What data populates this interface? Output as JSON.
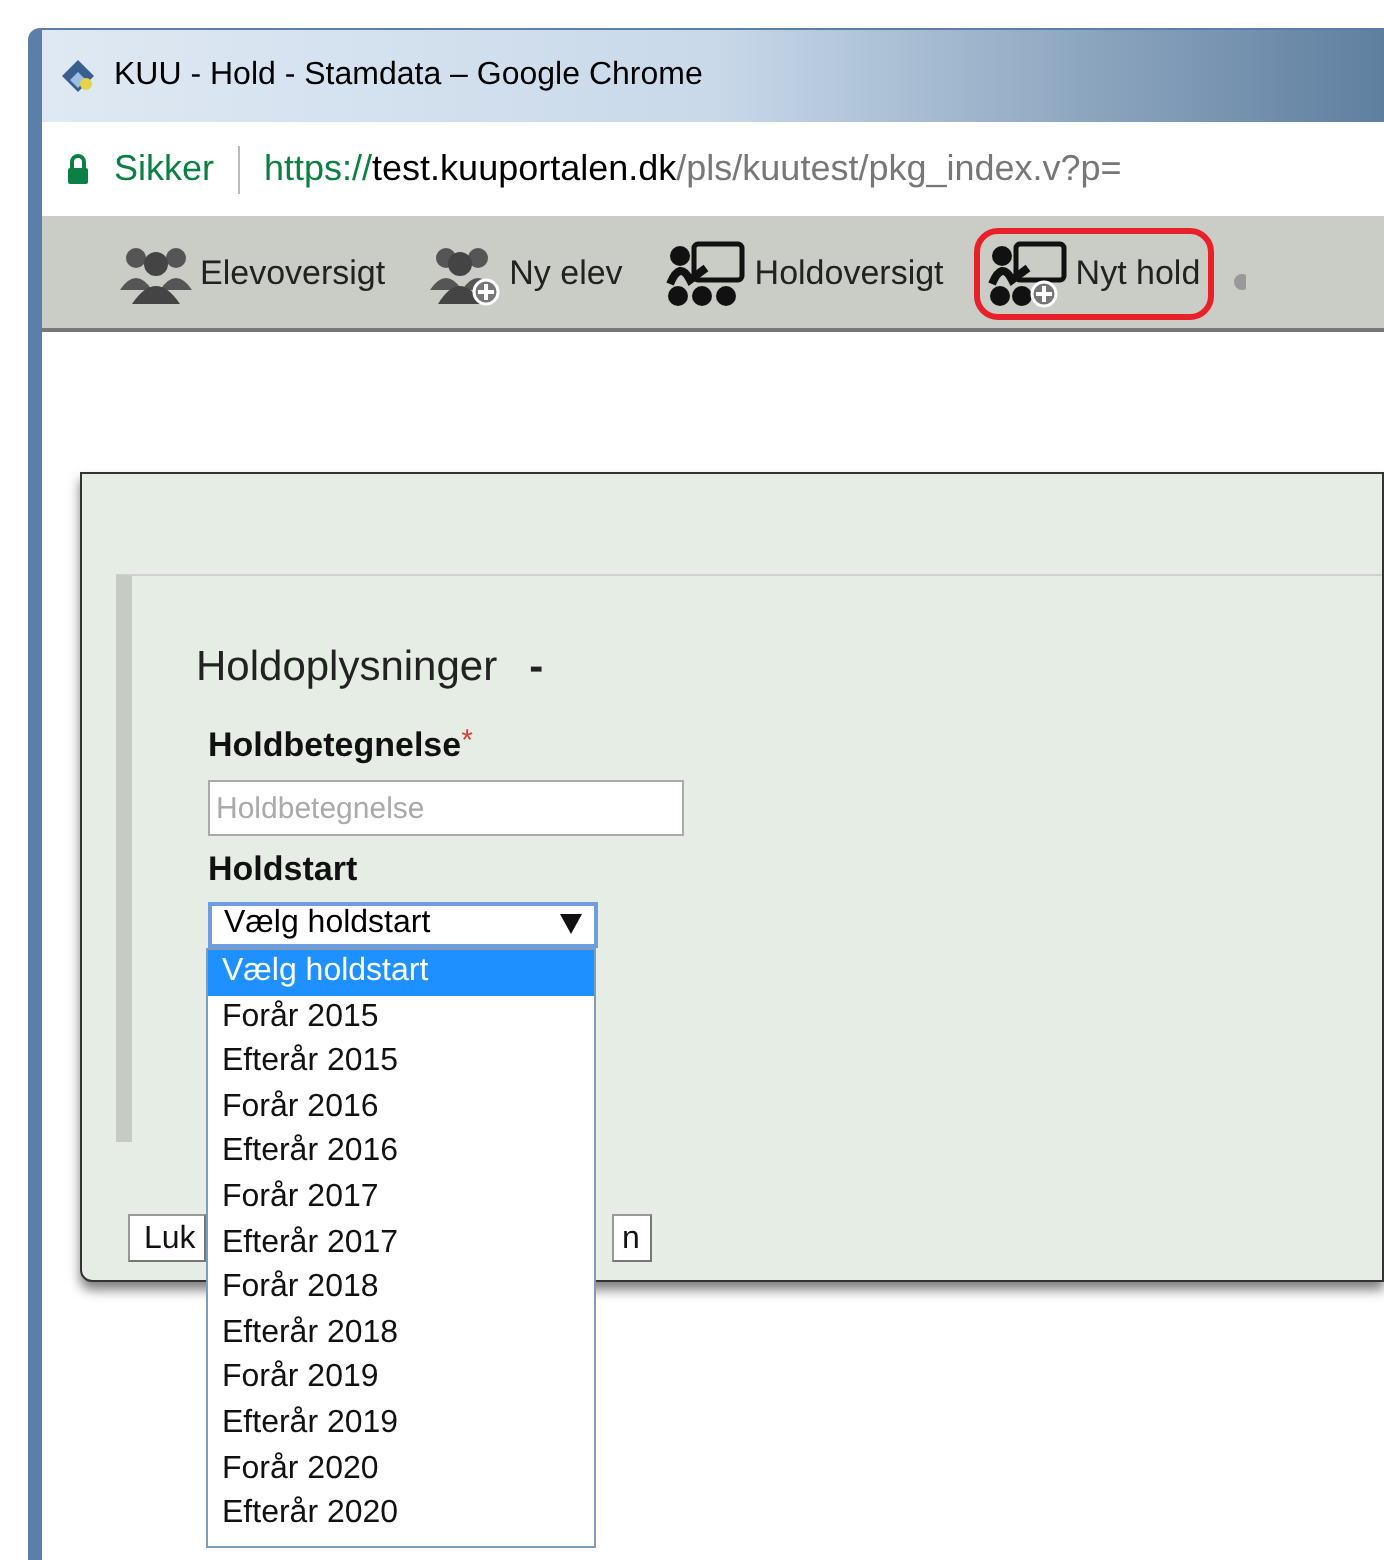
{
  "window": {
    "title": "KUU - Hold - Stamdata – Google Chrome"
  },
  "address_bar": {
    "security": "Sikker",
    "url_scheme": "https://",
    "url_host": "test.kuuportalen.dk",
    "url_path": "/pls/kuutest/pkg_index.v?p="
  },
  "toolbar": [
    {
      "label": "Elevoversigt",
      "kind": "students",
      "highlighted": false
    },
    {
      "label": "Ny elev",
      "kind": "add-student",
      "highlighted": false
    },
    {
      "label": "Holdoversigt",
      "kind": "teams",
      "highlighted": false
    },
    {
      "label": "Nyt hold",
      "kind": "add-team",
      "highlighted": true
    }
  ],
  "dialog": {
    "section_title": "Holdoplysninger",
    "section_suffix": "-",
    "fields": [
      {
        "kind": "text",
        "label": "Holdbetegnelse",
        "required_mark": "*",
        "placeholder": "Holdbetegnelse"
      },
      {
        "kind": "select",
        "label": "Holdstart",
        "value": "Vælg holdstart",
        "expanded": true,
        "options": [
          {
            "label": "Vælg holdstart",
            "selected": true
          },
          {
            "label": "Forår 2015",
            "selected": false
          },
          {
            "label": "Efterår 2015",
            "selected": false
          },
          {
            "label": "Forår 2016",
            "selected": false
          },
          {
            "label": "Efterår 2016",
            "selected": false
          },
          {
            "label": "Forår 2017",
            "selected": false
          },
          {
            "label": "Efterår 2017",
            "selected": false
          },
          {
            "label": "Forår 2018",
            "selected": false
          },
          {
            "label": "Efterår 2018",
            "selected": false
          },
          {
            "label": "Forår 2019",
            "selected": false
          },
          {
            "label": "Efterår 2019",
            "selected": false
          },
          {
            "label": "Forår 2020",
            "selected": false
          },
          {
            "label": "Efterår 2020",
            "selected": false
          }
        ]
      }
    ],
    "buttons": [
      "Luk",
      "n"
    ]
  }
}
